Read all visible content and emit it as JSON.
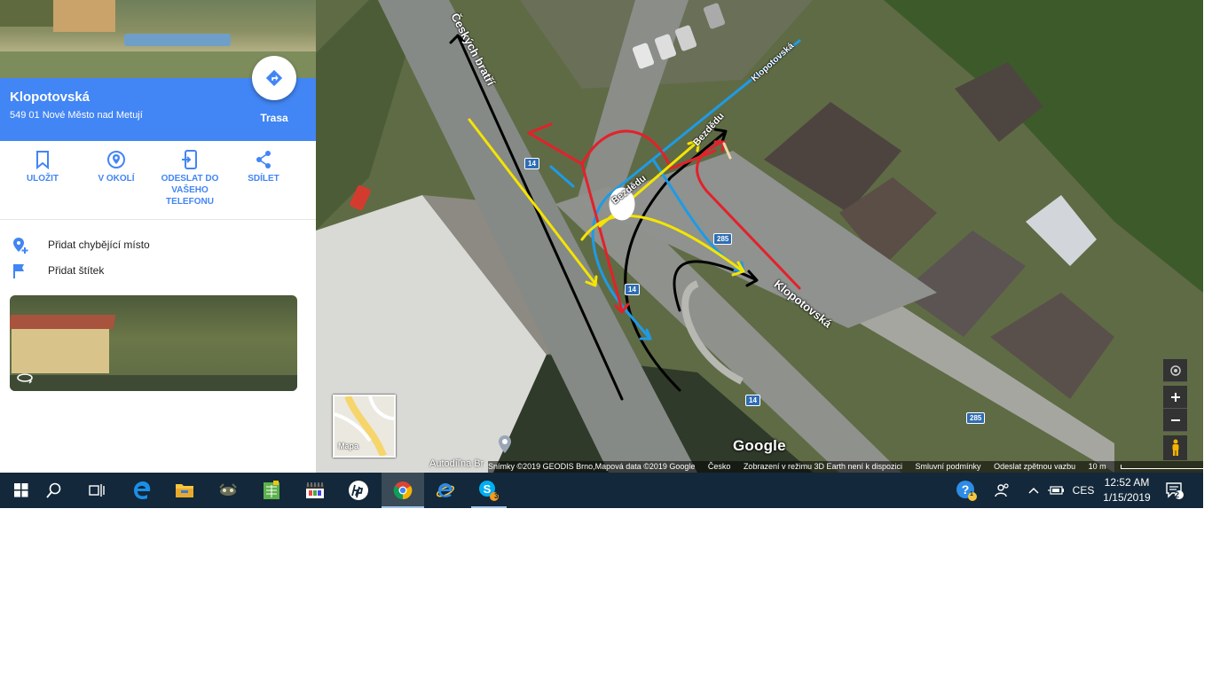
{
  "place": {
    "title": "Klopotovská",
    "address": "549 01 Nové Město nad Metují",
    "route_label": "Trasa"
  },
  "actions": [
    {
      "label": "ULOŽIT",
      "icon": "bookmark-icon"
    },
    {
      "label": "V OKOLÍ",
      "icon": "nearby-icon"
    },
    {
      "label": "ODESLAT DO VAŠEHO TELEFONU",
      "icon": "send-to-phone-icon"
    },
    {
      "label": "SDÍLET",
      "icon": "share-icon"
    }
  ],
  "add_missing_place": "Přidat chybějící místo",
  "add_label": "Přidat štítek",
  "map": {
    "road_labels": {
      "cesky_bratri": "Českých bratří",
      "klopotovska": "Klopotovská",
      "bezdeku": "Bezdědu",
      "upper": "Klopotovská"
    },
    "shields": [
      "14",
      "285",
      "14",
      "14",
      "285"
    ],
    "toggle_label": "Mapa",
    "poi_label": "Autodíľna Br",
    "logo": "Google",
    "attribution": {
      "imagery": "Snímky ©2019 GEODIS Brno,Mapová data ©2019 Google",
      "country": "Česko",
      "earth_notice": "Zobrazení v režimu 3D Earth není k dispozici",
      "terms": "Smluvní podmínky",
      "feedback": "Odeslat zpětnou vazbu",
      "scale": "10 m"
    },
    "annotation_colors": {
      "black": "#000000",
      "blue": "#1e9be6",
      "red": "#e3212b",
      "yellow": "#f5e400"
    }
  },
  "taskbar": {
    "apps": [
      "start-icon",
      "search-icon",
      "task-view-icon",
      "edge-icon",
      "file-explorer-icon",
      "app-icon",
      "spreadsheet-icon",
      "calendar-app-icon",
      "hp-icon",
      "chrome-icon",
      "internet-explorer-icon",
      "skype-icon"
    ],
    "skype_badge": "3",
    "help_badge": "1",
    "language": "CES",
    "time": "12:52 AM",
    "date": "1/15/2019",
    "notifications": "2"
  }
}
